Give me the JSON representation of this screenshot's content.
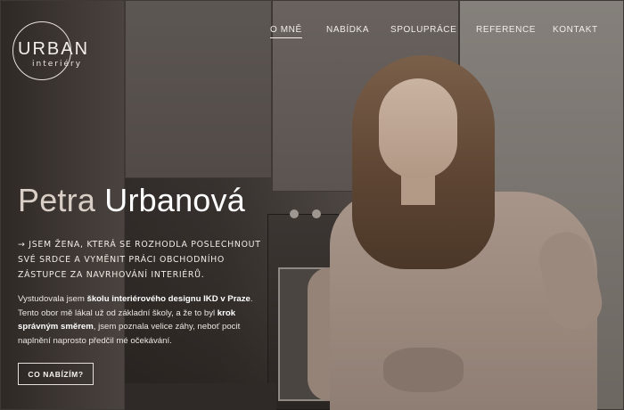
{
  "logo": {
    "word": "URBAN",
    "sub": "interiéry"
  },
  "nav": {
    "items": [
      {
        "label": "O MNĚ",
        "active": true
      },
      {
        "label": "NABÍDKA"
      },
      {
        "label": "SPOLUPRÁCE"
      },
      {
        "label": "REFERENCE"
      },
      {
        "label": "KONTAKT"
      }
    ]
  },
  "hero": {
    "first_name": "Petra",
    "last_name": "Urbanová",
    "tagline_prefix": "→",
    "tagline": "Jsem žena, která se rozhodla poslechnout své srdce a vyměnit práci obchodního zástupce za navrhování interiérů.",
    "bio": {
      "p1": "Vystudovala jsem ",
      "b1": "školu interiérového designu IKD v Praze",
      "p2": ". Tento obor mě lákal už od základní školy, a že to byl ",
      "b2": "krok správným směrem",
      "p3": ", jsem poznala velice záhy, neboť pocit naplnění naprosto předčil mé očekávání."
    },
    "cta_label": "CO NABÍZÍM?"
  }
}
